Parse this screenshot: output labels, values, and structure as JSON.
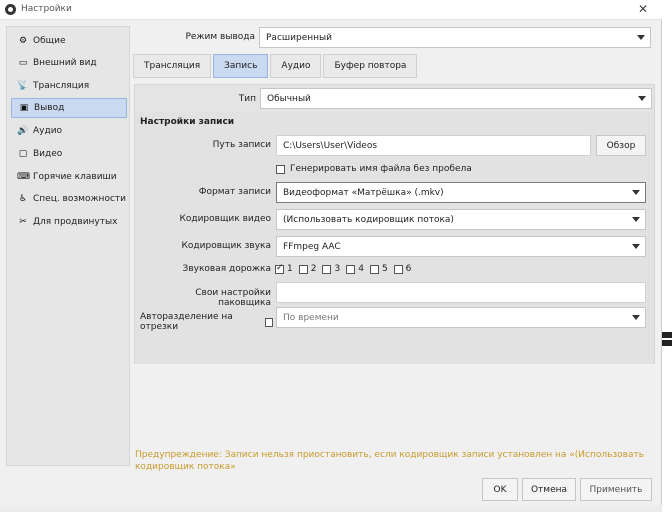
{
  "window": {
    "title": "Настройки"
  },
  "sidebar": {
    "items": [
      {
        "label": "Общие",
        "icon": "gear-icon",
        "glyph": "⚙"
      },
      {
        "label": "Внешний вид",
        "icon": "appearance-icon",
        "glyph": "▭"
      },
      {
        "label": "Трансляция",
        "icon": "stream-icon",
        "glyph": "📡"
      },
      {
        "label": "Вывод",
        "icon": "output-icon",
        "glyph": "▣",
        "active": true
      },
      {
        "label": "Аудио",
        "icon": "speaker-icon",
        "glyph": "🔊"
      },
      {
        "label": "Видео",
        "icon": "monitor-icon",
        "glyph": "▢"
      },
      {
        "label": "Горячие клавиши",
        "icon": "keyboard-icon",
        "glyph": "⌨"
      },
      {
        "label": "Спец. возможности",
        "icon": "accessibility-icon",
        "glyph": "♿"
      },
      {
        "label": "Для продвинутых",
        "icon": "tools-icon",
        "glyph": "✂"
      }
    ]
  },
  "output_mode": {
    "label": "Режим вывода",
    "value": "Расширенный"
  },
  "tabs": [
    "Трансляция",
    "Запись",
    "Аудио",
    "Буфер повтора"
  ],
  "active_tab": "Запись",
  "type": {
    "label": "Тип",
    "value": "Обычный"
  },
  "recording": {
    "group_title": "Настройки записи",
    "path_label": "Путь записи",
    "path_value": "C:\\Users\\User\\Videos",
    "browse_button": "Обзор",
    "no_space_label": "Генерировать имя файла без пробела",
    "format_label": "Формат записи",
    "format_value": "Видеоформат «Матрёшка» (.mkv)",
    "video_encoder_label": "Кодировщик видео",
    "video_encoder_value": "(Использовать кодировщик потока)",
    "audio_encoder_label": "Кодировщик звука",
    "audio_encoder_value": "FFmpeg AAC",
    "audio_track_label": "Звуковая дорожка",
    "tracks": [
      "1",
      "2",
      "3",
      "4",
      "5",
      "6"
    ],
    "tracks_checked": [
      true,
      false,
      false,
      false,
      false,
      false
    ],
    "muxer_label": "Свои настройки паковщика",
    "muxer_value": "",
    "split_label": "Авторазделение на отрезки",
    "split_value": "По времени"
  },
  "warning": "Предупреждение: Записи нельзя приостановить, если кодировщик записи установлен на «(Использовать кодировщик потока»",
  "buttons": {
    "ok": "OK",
    "cancel": "Отмена",
    "apply": "Применить"
  }
}
